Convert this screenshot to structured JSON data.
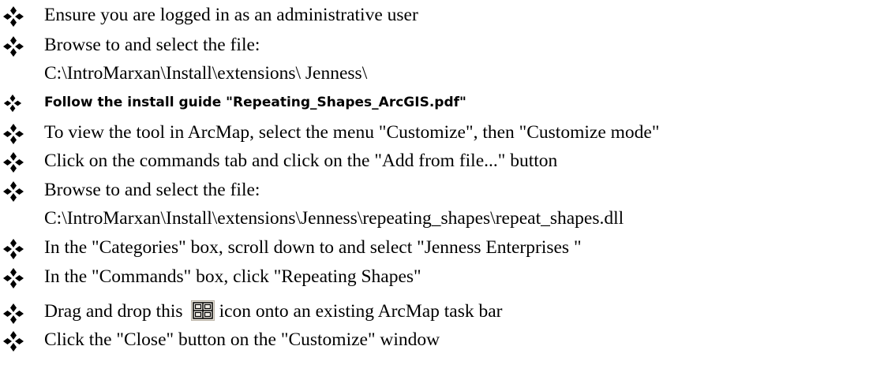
{
  "bullet_icon": "four-diamond-bullet-icon",
  "toolbar_icon": "repeating-shapes-grid-icon",
  "items": [
    {
      "text": "Ensure you are logged in as an administrative user"
    },
    {
      "text": "Browse to and select the file:",
      "line2": "C:\\IntroMarxan\\Install\\extensions\\ Jenness\\"
    },
    {
      "text": "Follow the install guide \"Repeating_Shapes_ArcGIS.pdf\""
    },
    {
      "text": "To view the tool in ArcMap, select the menu \"Customize\", then \"Customize mode\""
    },
    {
      "text": "Click on the commands tab and click on the \"Add from file...\" button"
    },
    {
      "text": "Browse to and select the file:",
      "line2": "C:\\IntroMarxan\\Install\\extensions\\Jenness\\repeating_shapes\\repeat_shapes.dll"
    },
    {
      "text": "In the \"Categories\" box, scroll down to and select \"Jenness Enterprises \""
    },
    {
      "text": "In the \"Commands\" box, click \"Repeating Shapes\""
    },
    {
      "text_before": "Drag and drop this",
      "text_after": "icon onto an existing ArcMap task bar"
    },
    {
      "text": "Click the \"Close\" button on the \"Customize\" window"
    }
  ]
}
